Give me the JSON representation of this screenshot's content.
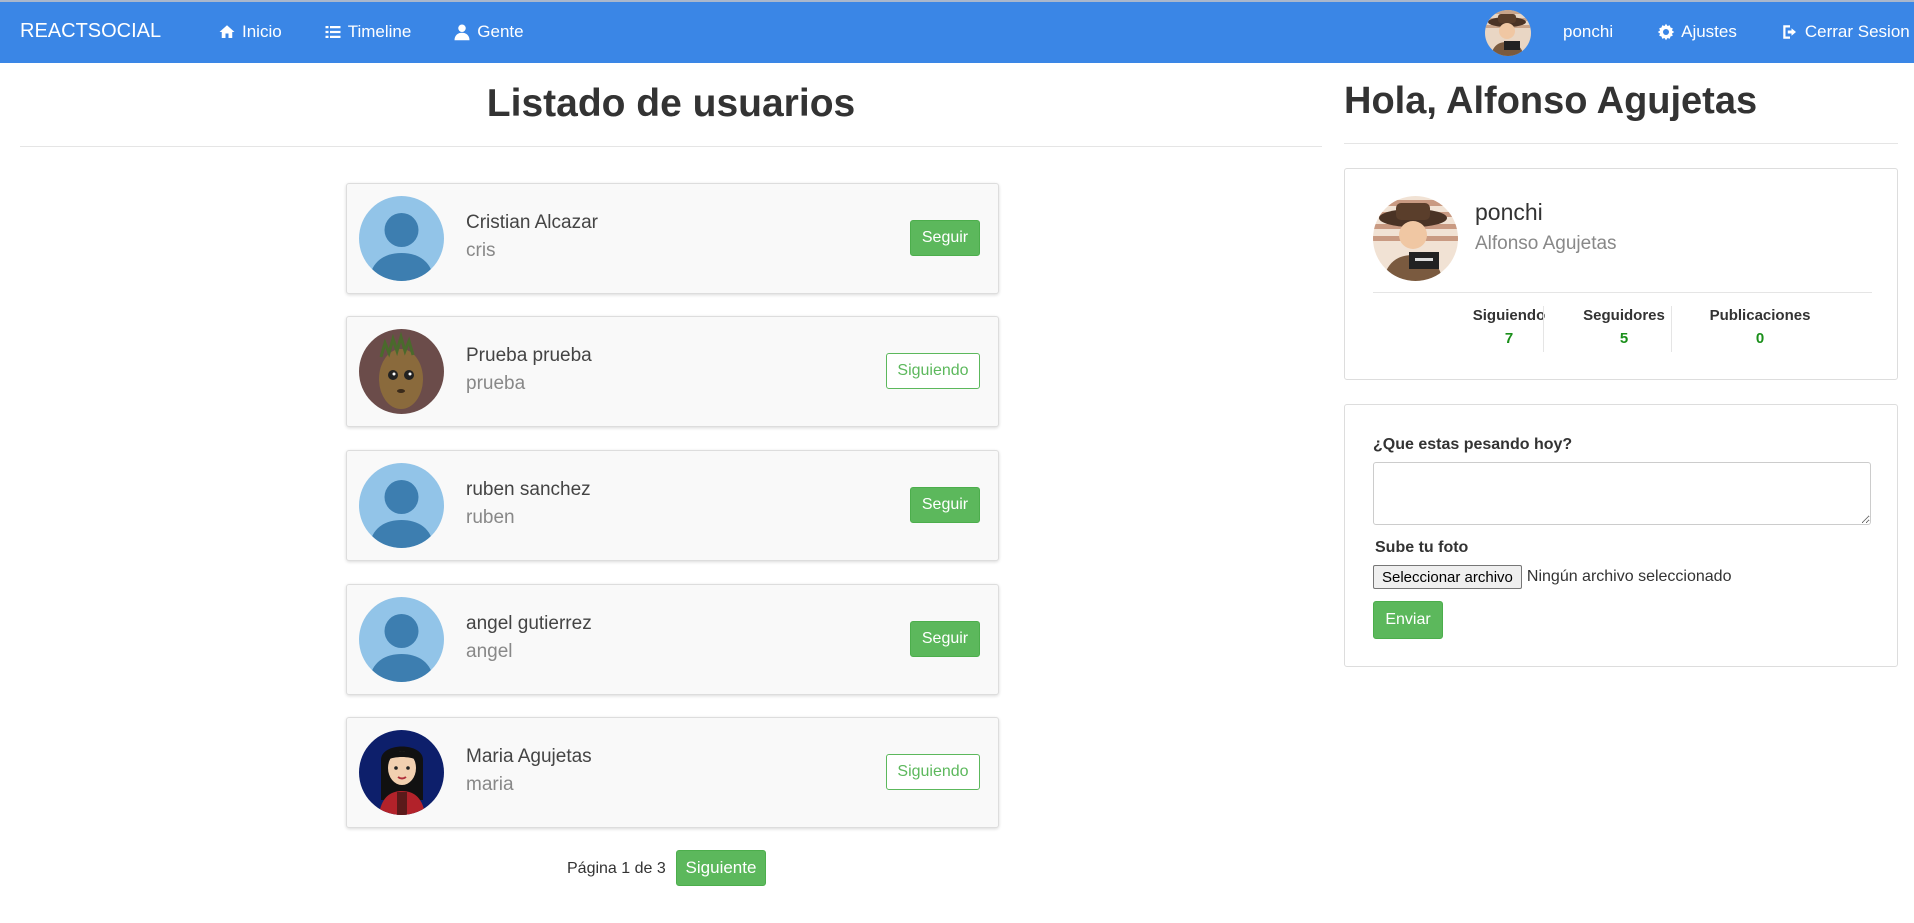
{
  "navbar": {
    "brand": "REACTSOCIAL",
    "links": [
      {
        "label": "Inicio",
        "icon": "home-icon"
      },
      {
        "label": "Timeline",
        "icon": "list-icon"
      },
      {
        "label": "Gente",
        "icon": "user-icon"
      }
    ],
    "user_nick": "ponchi",
    "settings_label": "Ajustes",
    "logout_label": "Cerrar Sesion",
    "colors": {
      "background": "#3a86e6"
    }
  },
  "users_section": {
    "title": "Listado de usuarios",
    "users": [
      {
        "name": "Cristian Alcazar",
        "nick": "cris",
        "action": "Seguir",
        "avatar": "default-avatar"
      },
      {
        "name": "Prueba prueba",
        "nick": "prueba",
        "action": "Siguiendo",
        "avatar": "groot-avatar"
      },
      {
        "name": "ruben sanchez",
        "nick": "ruben",
        "action": "Seguir",
        "avatar": "default-avatar"
      },
      {
        "name": "angel gutierrez",
        "nick": "angel",
        "action": "Seguir",
        "avatar": "default-avatar"
      },
      {
        "name": "Maria Agujetas",
        "nick": "maria",
        "action": "Siguiendo",
        "avatar": "mulan-avatar"
      }
    ],
    "pagination": {
      "text": "Página 1 de 3",
      "next_label": "Siguiente"
    }
  },
  "sidebar": {
    "greeting": "Hola, Alfonso Agujetas",
    "profile": {
      "nick": "ponchi",
      "name": "Alfonso Agujetas",
      "stats": [
        {
          "label": "Siguiendo",
          "value": "7"
        },
        {
          "label": "Seguidores",
          "value": "5"
        },
        {
          "label": "Publicaciones",
          "value": "0"
        }
      ]
    },
    "post_form": {
      "question_label": "¿Que estas pesando hoy?",
      "textarea_value": "",
      "photo_label": "Sube tu foto",
      "file_button_label": "Seleccionar archivo",
      "file_status": "Ningún archivo seleccionado",
      "submit_label": "Enviar"
    }
  },
  "colors": {
    "accent_green": "#5cb85c",
    "stat_green": "#1a8f1a"
  }
}
